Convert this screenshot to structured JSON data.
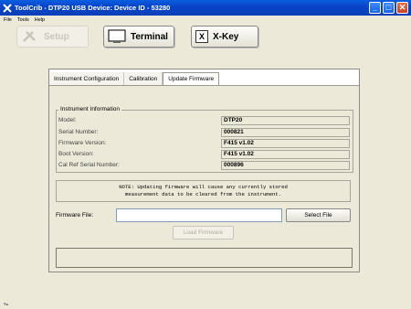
{
  "window": {
    "title": "ToolCrib - DTP20 USB Device: Device ID - 53280",
    "app_icon": "wrench-cross-icon",
    "minimize_glyph": "_",
    "maximize_glyph": "□",
    "close_glyph": "✕"
  },
  "menu": {
    "file": "File",
    "tools": "Tools",
    "help": "Help"
  },
  "toolbar": {
    "setup": "Setup",
    "terminal": "Terminal",
    "xkey": "X-Key",
    "xkey_glyph": "X"
  },
  "tabs": [
    {
      "label": "Instrument Configuration"
    },
    {
      "label": "Calibration"
    },
    {
      "label": "Update Firmware"
    }
  ],
  "instrument_info": {
    "title": "Instrument Information",
    "rows": [
      {
        "label": "Model:",
        "value": "DTP20"
      },
      {
        "label": "Serial Number:",
        "value": "000821"
      },
      {
        "label": "Firmware Version:",
        "value": "F415 v1.02"
      },
      {
        "label": "Boot Version:",
        "value": "F415 v1.02"
      },
      {
        "label": "Cal Ref Serial Number:",
        "value": "000896"
      }
    ]
  },
  "note": "NOTE: Updating firmware will cause any currently stored\nmeasurement data to be cleared from the instrument.",
  "firmware": {
    "label": "Firmware File:",
    "value": "",
    "select_button": "Select File",
    "load_button": "Load Firmware"
  },
  "status_text": "",
  "colors": {
    "titlebar": "#0845c8",
    "background": "#ece9d8",
    "close_button": "#c84222"
  }
}
